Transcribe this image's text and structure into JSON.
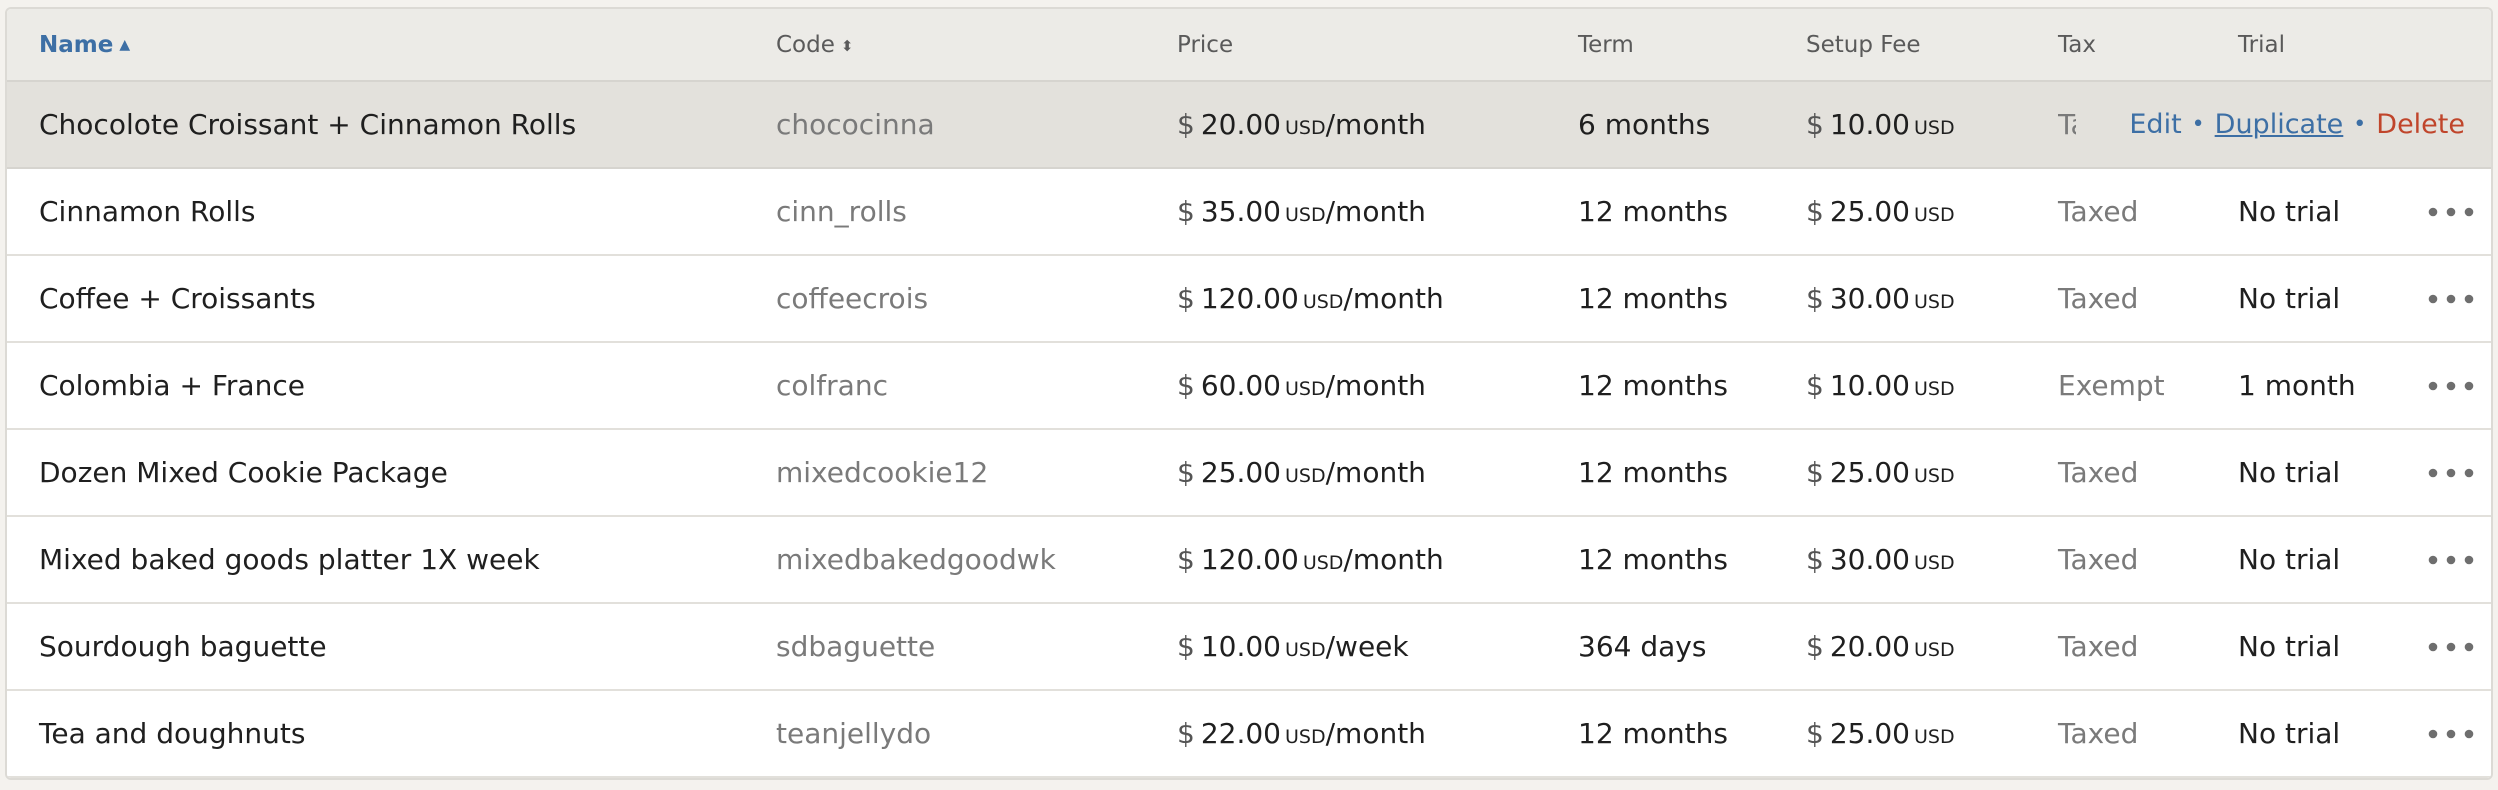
{
  "header": {
    "name": "Name",
    "code": "Code",
    "price": "Price",
    "term": "Term",
    "setup_fee": "Setup Fee",
    "tax": "Tax",
    "trial": "Trial"
  },
  "currency_symbol": "$",
  "currency_code": "USD",
  "actions": {
    "edit": "Edit",
    "duplicate": "Duplicate",
    "delete": "Delete",
    "separator": "•"
  },
  "rows": [
    {
      "name": "Chocolote Croissant + Cinnamon Rolls",
      "code": "chococinna",
      "price": "20.00",
      "period": "/month",
      "term": "6 months",
      "setup_fee": "10.00",
      "tax": "Taxed",
      "trial": "",
      "hovered": true
    },
    {
      "name": "Cinnamon Rolls",
      "code": "cinn_rolls",
      "price": "35.00",
      "period": "/month",
      "term": "12 months",
      "setup_fee": "25.00",
      "tax": "Taxed",
      "trial": "No trial"
    },
    {
      "name": "Coffee + Croissants",
      "code": "coffeecrois",
      "price": "120.00",
      "period": "/month",
      "term": "12 months",
      "setup_fee": "30.00",
      "tax": "Taxed",
      "trial": "No trial"
    },
    {
      "name": "Colombia + France",
      "code": "colfranc",
      "price": "60.00",
      "period": "/month",
      "term": "12 months",
      "setup_fee": "10.00",
      "tax": "Exempt",
      "trial": "1 month"
    },
    {
      "name": "Dozen Mixed Cookie Package",
      "code": "mixedcookie12",
      "price": "25.00",
      "period": "/month",
      "term": "12 months",
      "setup_fee": "25.00",
      "tax": "Taxed",
      "trial": "No trial"
    },
    {
      "name": "Mixed baked goods platter 1X week",
      "code": "mixedbakedgoodwk",
      "price": "120.00",
      "period": "/month",
      "term": "12 months",
      "setup_fee": "30.00",
      "tax": "Taxed",
      "trial": "No trial"
    },
    {
      "name": "Sourdough baguette",
      "code": "sdbaguette",
      "price": "10.00",
      "period": "/week",
      "term": "364 days",
      "setup_fee": "20.00",
      "tax": "Taxed",
      "trial": "No trial"
    },
    {
      "name": "Tea and doughnuts",
      "code": "teanjellydo",
      "price": "22.00",
      "period": "/month",
      "term": "12 months",
      "setup_fee": "25.00",
      "tax": "Taxed",
      "trial": "No trial"
    }
  ],
  "colors": {
    "link": "#3d6fa5",
    "delete": "#c0452b",
    "header_bg": "#ecebe7",
    "hover_row": "#e3e1dc"
  },
  "icons": {
    "sort_asc": "caret-up-icon",
    "sort_both": "sort-icon",
    "row_menu": "more-horizontal-icon"
  }
}
